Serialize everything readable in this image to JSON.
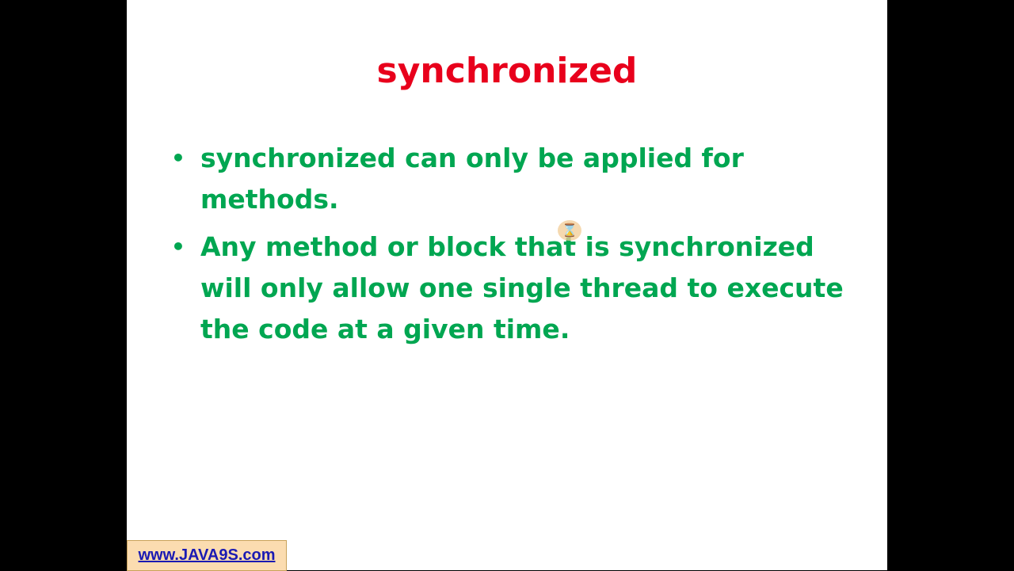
{
  "slide": {
    "title": "synchronized",
    "bullet_marker": "•",
    "bullets": [
      "synchronized can only be applied for methods.",
      "Any method or block that is synchronized will only allow one single thread to execute the code at a given time."
    ]
  },
  "cursor": {
    "icon": "hourglass-icon",
    "glyph": "⌛"
  },
  "watermark": {
    "text": "www.JAVA9S.com"
  },
  "colors": {
    "background": "#000000",
    "slide": "#ffffff",
    "title": "#e8001c",
    "bullet_text": "#00a651",
    "watermark_bg": "#fbdcb0",
    "watermark_text": "#1a1ab3"
  }
}
